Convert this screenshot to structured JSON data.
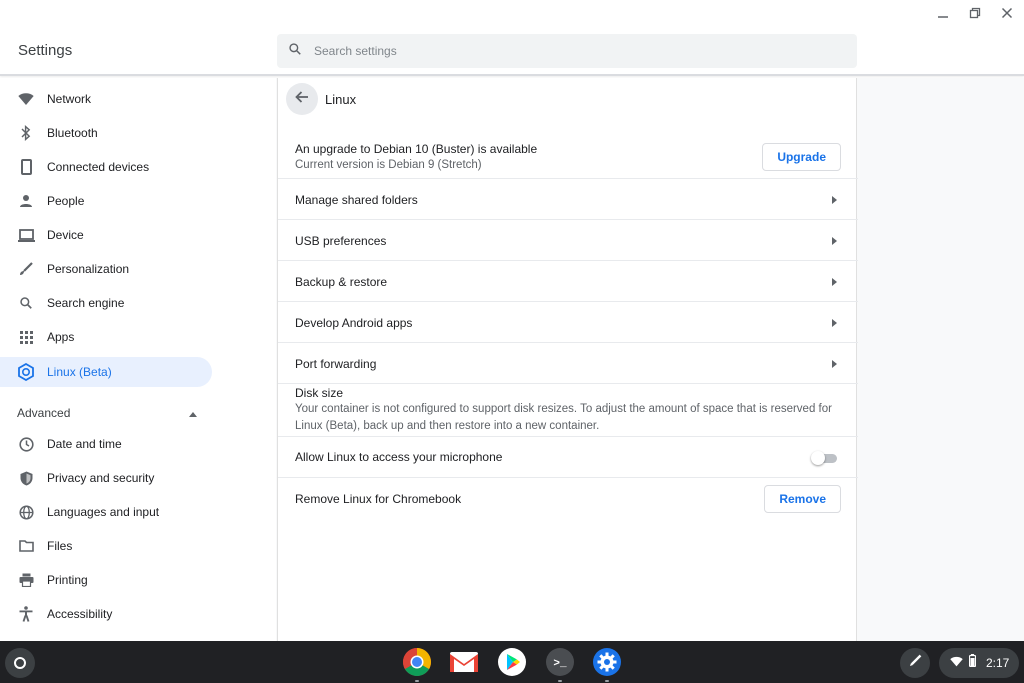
{
  "app": {
    "title": "Settings"
  },
  "search": {
    "placeholder": "Search settings"
  },
  "sidebar": {
    "items": [
      {
        "label": "Network",
        "icon": "wifi-icon"
      },
      {
        "label": "Bluetooth",
        "icon": "bluetooth-icon"
      },
      {
        "label": "Connected devices",
        "icon": "phone-icon"
      },
      {
        "label": "People",
        "icon": "person-icon"
      },
      {
        "label": "Device",
        "icon": "laptop-icon"
      },
      {
        "label": "Personalization",
        "icon": "brush-icon"
      },
      {
        "label": "Search engine",
        "icon": "search-icon"
      },
      {
        "label": "Apps",
        "icon": "apps-grid-icon"
      },
      {
        "label": "Linux (Beta)",
        "icon": "penguin-icon",
        "active": true
      }
    ],
    "advanced_label": "Advanced",
    "advanced_items": [
      {
        "label": "Date and time",
        "icon": "clock-icon"
      },
      {
        "label": "Privacy and security",
        "icon": "shield-icon"
      },
      {
        "label": "Languages and input",
        "icon": "globe-icon"
      },
      {
        "label": "Files",
        "icon": "folder-icon"
      },
      {
        "label": "Printing",
        "icon": "printer-icon"
      },
      {
        "label": "Accessibility",
        "icon": "accessibility-icon"
      }
    ]
  },
  "main": {
    "title": "Linux",
    "upgrade": {
      "title": "An upgrade to Debian 10 (Buster) is available",
      "subtitle": "Current version is Debian 9 (Stretch)",
      "button": "Upgrade"
    },
    "links": [
      "Manage shared folders",
      "USB preferences",
      "Backup & restore",
      "Develop Android apps",
      "Port forwarding"
    ],
    "disk": {
      "title": "Disk size",
      "description": "Your container is not configured to support disk resizes. To adjust the amount of space that is reserved for Linux (Beta), back up and then restore into a new container."
    },
    "microphone": {
      "label": "Allow Linux to access your microphone",
      "enabled": false
    },
    "remove": {
      "label": "Remove Linux for Chromebook",
      "button": "Remove"
    }
  },
  "shelf": {
    "apps": [
      "chrome-icon",
      "gmail-icon",
      "play-store-icon",
      "terminal-icon",
      "settings-icon"
    ],
    "terminal_glyph": ">_",
    "time": "2:17"
  },
  "colors": {
    "accent": "#1a73e8",
    "active_bg": "#e8f0fe",
    "shelf": "#202124"
  }
}
